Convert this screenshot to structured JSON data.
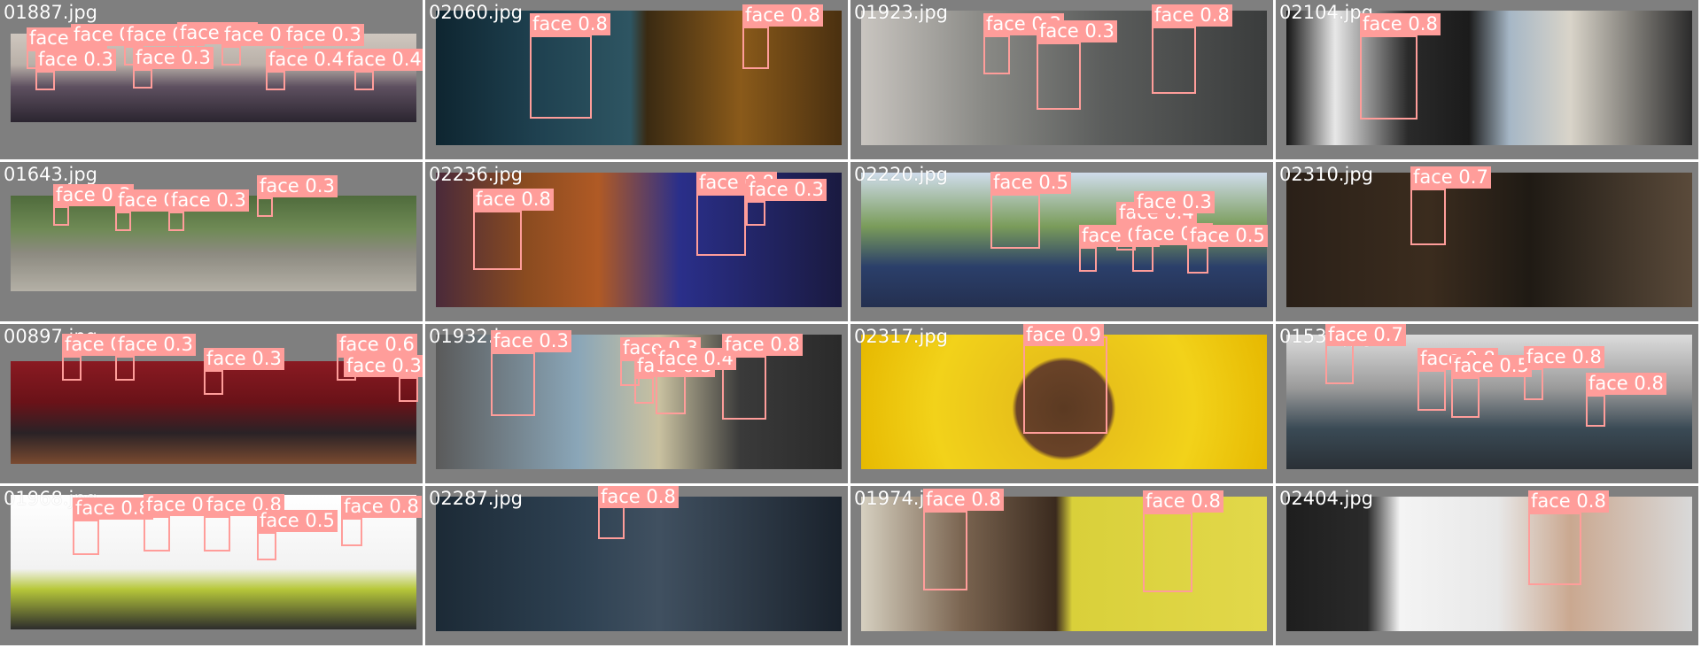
{
  "box_color": "#ff9d9a",
  "background_color": "#808080",
  "tiles": [
    {
      "filename": "01887.jpg",
      "bg": "linear-gradient(180deg,#cfc7bf 0%,#b9b0a8 35%,#5e5060 60%,#2b2530 100%)",
      "faces": [
        {
          "label": "face 0.3"
        },
        {
          "label": "face 0.3"
        },
        {
          "label": "face 0.3"
        },
        {
          "label": "face 0.3"
        },
        {
          "label": "face 0.3"
        },
        {
          "label": "face 0.3"
        },
        {
          "label": "face 0.3"
        },
        {
          "label": "face 0.3"
        },
        {
          "label": "face 0.4"
        },
        {
          "label": "face 0.4"
        }
      ]
    },
    {
      "filename": "02060.jpg",
      "bg": "linear-gradient(90deg,#0e2530 0%,#1f4150 25%,#2e5562 48%,#3a2a12 52%,#8a5a1a 75%,#4a3010 100%)",
      "faces": [
        {
          "label": "face 0.8"
        },
        {
          "label": "face 0.8"
        }
      ]
    },
    {
      "filename": "01923.jpg",
      "bg": "linear-gradient(90deg,#c9c5c0 0%,#8a8a86 30%,#5b5d5c 60%,#3a3c3c 100%)",
      "faces": [
        {
          "label": "face 0.3"
        },
        {
          "label": "face 0.3"
        },
        {
          "label": "face 0.8"
        }
      ]
    },
    {
      "filename": "02104.jpg",
      "bg": "linear-gradient(90deg,#141414 0%,#e8e8e8 12%,#2a2a2a 30%,#1b1b1b 45%,#a6b7c6 55%,#d9d4c9 70%,#2b2b2b 100%)",
      "faces": [
        {
          "label": "face 0.8"
        }
      ]
    },
    {
      "filename": "01643.jpg",
      "bg": "linear-gradient(180deg,#4f6b3c 0%,#6f8a55 35%,#8c8a80 60%,#b4b0a6 100%)",
      "faces": [
        {
          "label": "face 0.3"
        },
        {
          "label": "face 0.3"
        },
        {
          "label": "face 0.3"
        },
        {
          "label": "face 0.3"
        }
      ]
    },
    {
      "filename": "02236.jpg",
      "bg": "linear-gradient(90deg,#4a2a3a 0%,#8a4b20 22%,#b05a25 40%,#2a2f8a 60%,#1a1a40 100%)",
      "faces": [
        {
          "label": "face 0.8"
        },
        {
          "label": "face 0.8"
        },
        {
          "label": "face 0.3"
        }
      ]
    },
    {
      "filename": "02220.jpg",
      "bg": "linear-gradient(180deg,#cfdceb 0%,#7a9c5a 40%,#2b3f6a 70%,#243050 100%)",
      "faces": [
        {
          "label": "face 0.5"
        },
        {
          "label": "face 0.3"
        },
        {
          "label": "face 0.4"
        },
        {
          "label": "face 0.3"
        },
        {
          "label": "face 0.3"
        },
        {
          "label": "face 0.5"
        }
      ]
    },
    {
      "filename": "02310.jpg",
      "bg": "linear-gradient(90deg,#2a2018 0%,#3b2c1e 35%,#1f1a14 60%,#5a4a3a 100%)",
      "faces": [
        {
          "label": "face 0.7"
        }
      ]
    },
    {
      "filename": "00897.jpg",
      "bg": "linear-gradient(180deg,#8a1a22 0%,#6a1218 40%,#2a2226 70%,#7a4a30 100%)",
      "faces": [
        {
          "label": "face 0.4"
        },
        {
          "label": "face 0.3"
        },
        {
          "label": "face 0.3"
        },
        {
          "label": "face 0.6"
        },
        {
          "label": "face 0.3"
        }
      ]
    },
    {
      "filename": "01932.jpg",
      "bg": "linear-gradient(90deg,#5a5a5a 0%,#8aa6b8 35%,#c9c1a0 55%,#3a3a3a 75%,#2a2a2a 100%)",
      "faces": [
        {
          "label": "face 0.3"
        },
        {
          "label": "face 0.3"
        },
        {
          "label": "face 0.3"
        },
        {
          "label": "face 0.4"
        },
        {
          "label": "face 0.8"
        }
      ]
    },
    {
      "filename": "02317.jpg",
      "bg": "radial-gradient(circle at 50% 55%,#5b3a22 0%,#6a4328 22%,#e8c11a 24%,#f2d21a 60%,#e6b800 100%)",
      "faces": [
        {
          "label": "face 0.9"
        }
      ]
    },
    {
      "filename": "01533.jpg",
      "bg": "linear-gradient(180deg,#dcdcdc 0%,#9a9a9a 40%,#3a4a55 70%,#2a3036 100%)",
      "faces": [
        {
          "label": "face 0.7"
        },
        {
          "label": "face 0.8"
        },
        {
          "label": "face 0.5"
        },
        {
          "label": "face 0.8"
        },
        {
          "label": "face 0.8"
        }
      ]
    },
    {
      "filename": "01968.jpg",
      "bg": "linear-gradient(180deg,#ffffff 0%,#f2f2f2 55%,#b7c83a 70%,#2c2c2c 100%)",
      "faces": [
        {
          "label": "face 0.8"
        },
        {
          "label": "face 0.8"
        },
        {
          "label": "face 0.8"
        },
        {
          "label": "face 0.5"
        },
        {
          "label": "face 0.8"
        }
      ]
    },
    {
      "filename": "02287.jpg",
      "bg": "linear-gradient(90deg,#1c2a36 0%,#2e4152 35%,#405060 55%,#1a222c 100%)",
      "faces": [
        {
          "label": "face 0.8"
        }
      ]
    },
    {
      "filename": "01974.jpg",
      "bg": "linear-gradient(90deg,#d6d0c0 0%,#7a6450 25%,#3a2a1e 48%,#d9d03a 52%,#e2d84a 100%)",
      "faces": [
        {
          "label": "face 0.8"
        },
        {
          "label": "face 0.8"
        }
      ]
    },
    {
      "filename": "02404.jpg",
      "bg": "linear-gradient(90deg,#1e1e1e 0%,#2a2a2a 20%,#f4f4f4 28%,#e8e8e8 52%,#caa890 70%,#d9d9d9 100%)",
      "faces": [
        {
          "label": "face 0.8"
        }
      ]
    }
  ]
}
